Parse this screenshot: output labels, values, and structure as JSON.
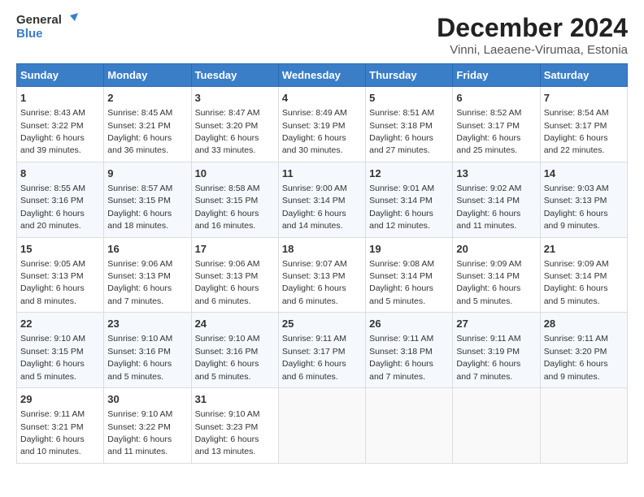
{
  "header": {
    "logo_line1": "General",
    "logo_line2": "Blue",
    "title": "December 2024",
    "subtitle": "Vinni, Laeaene-Virumaa, Estonia"
  },
  "columns": [
    "Sunday",
    "Monday",
    "Tuesday",
    "Wednesday",
    "Thursday",
    "Friday",
    "Saturday"
  ],
  "weeks": [
    [
      {
        "day": "1",
        "info": "Sunrise: 8:43 AM\nSunset: 3:22 PM\nDaylight: 6 hours\nand 39 minutes."
      },
      {
        "day": "2",
        "info": "Sunrise: 8:45 AM\nSunset: 3:21 PM\nDaylight: 6 hours\nand 36 minutes."
      },
      {
        "day": "3",
        "info": "Sunrise: 8:47 AM\nSunset: 3:20 PM\nDaylight: 6 hours\nand 33 minutes."
      },
      {
        "day": "4",
        "info": "Sunrise: 8:49 AM\nSunset: 3:19 PM\nDaylight: 6 hours\nand 30 minutes."
      },
      {
        "day": "5",
        "info": "Sunrise: 8:51 AM\nSunset: 3:18 PM\nDaylight: 6 hours\nand 27 minutes."
      },
      {
        "day": "6",
        "info": "Sunrise: 8:52 AM\nSunset: 3:17 PM\nDaylight: 6 hours\nand 25 minutes."
      },
      {
        "day": "7",
        "info": "Sunrise: 8:54 AM\nSunset: 3:17 PM\nDaylight: 6 hours\nand 22 minutes."
      }
    ],
    [
      {
        "day": "8",
        "info": "Sunrise: 8:55 AM\nSunset: 3:16 PM\nDaylight: 6 hours\nand 20 minutes."
      },
      {
        "day": "9",
        "info": "Sunrise: 8:57 AM\nSunset: 3:15 PM\nDaylight: 6 hours\nand 18 minutes."
      },
      {
        "day": "10",
        "info": "Sunrise: 8:58 AM\nSunset: 3:15 PM\nDaylight: 6 hours\nand 16 minutes."
      },
      {
        "day": "11",
        "info": "Sunrise: 9:00 AM\nSunset: 3:14 PM\nDaylight: 6 hours\nand 14 minutes."
      },
      {
        "day": "12",
        "info": "Sunrise: 9:01 AM\nSunset: 3:14 PM\nDaylight: 6 hours\nand 12 minutes."
      },
      {
        "day": "13",
        "info": "Sunrise: 9:02 AM\nSunset: 3:14 PM\nDaylight: 6 hours\nand 11 minutes."
      },
      {
        "day": "14",
        "info": "Sunrise: 9:03 AM\nSunset: 3:13 PM\nDaylight: 6 hours\nand 9 minutes."
      }
    ],
    [
      {
        "day": "15",
        "info": "Sunrise: 9:05 AM\nSunset: 3:13 PM\nDaylight: 6 hours\nand 8 minutes."
      },
      {
        "day": "16",
        "info": "Sunrise: 9:06 AM\nSunset: 3:13 PM\nDaylight: 6 hours\nand 7 minutes."
      },
      {
        "day": "17",
        "info": "Sunrise: 9:06 AM\nSunset: 3:13 PM\nDaylight: 6 hours\nand 6 minutes."
      },
      {
        "day": "18",
        "info": "Sunrise: 9:07 AM\nSunset: 3:13 PM\nDaylight: 6 hours\nand 6 minutes."
      },
      {
        "day": "19",
        "info": "Sunrise: 9:08 AM\nSunset: 3:14 PM\nDaylight: 6 hours\nand 5 minutes."
      },
      {
        "day": "20",
        "info": "Sunrise: 9:09 AM\nSunset: 3:14 PM\nDaylight: 6 hours\nand 5 minutes."
      },
      {
        "day": "21",
        "info": "Sunrise: 9:09 AM\nSunset: 3:14 PM\nDaylight: 6 hours\nand 5 minutes."
      }
    ],
    [
      {
        "day": "22",
        "info": "Sunrise: 9:10 AM\nSunset: 3:15 PM\nDaylight: 6 hours\nand 5 minutes."
      },
      {
        "day": "23",
        "info": "Sunrise: 9:10 AM\nSunset: 3:16 PM\nDaylight: 6 hours\nand 5 minutes."
      },
      {
        "day": "24",
        "info": "Sunrise: 9:10 AM\nSunset: 3:16 PM\nDaylight: 6 hours\nand 5 minutes."
      },
      {
        "day": "25",
        "info": "Sunrise: 9:11 AM\nSunset: 3:17 PM\nDaylight: 6 hours\nand 6 minutes."
      },
      {
        "day": "26",
        "info": "Sunrise: 9:11 AM\nSunset: 3:18 PM\nDaylight: 6 hours\nand 7 minutes."
      },
      {
        "day": "27",
        "info": "Sunrise: 9:11 AM\nSunset: 3:19 PM\nDaylight: 6 hours\nand 7 minutes."
      },
      {
        "day": "28",
        "info": "Sunrise: 9:11 AM\nSunset: 3:20 PM\nDaylight: 6 hours\nand 9 minutes."
      }
    ],
    [
      {
        "day": "29",
        "info": "Sunrise: 9:11 AM\nSunset: 3:21 PM\nDaylight: 6 hours\nand 10 minutes."
      },
      {
        "day": "30",
        "info": "Sunrise: 9:10 AM\nSunset: 3:22 PM\nDaylight: 6 hours\nand 11 minutes."
      },
      {
        "day": "31",
        "info": "Sunrise: 9:10 AM\nSunset: 3:23 PM\nDaylight: 6 hours\nand 13 minutes."
      },
      null,
      null,
      null,
      null
    ]
  ]
}
